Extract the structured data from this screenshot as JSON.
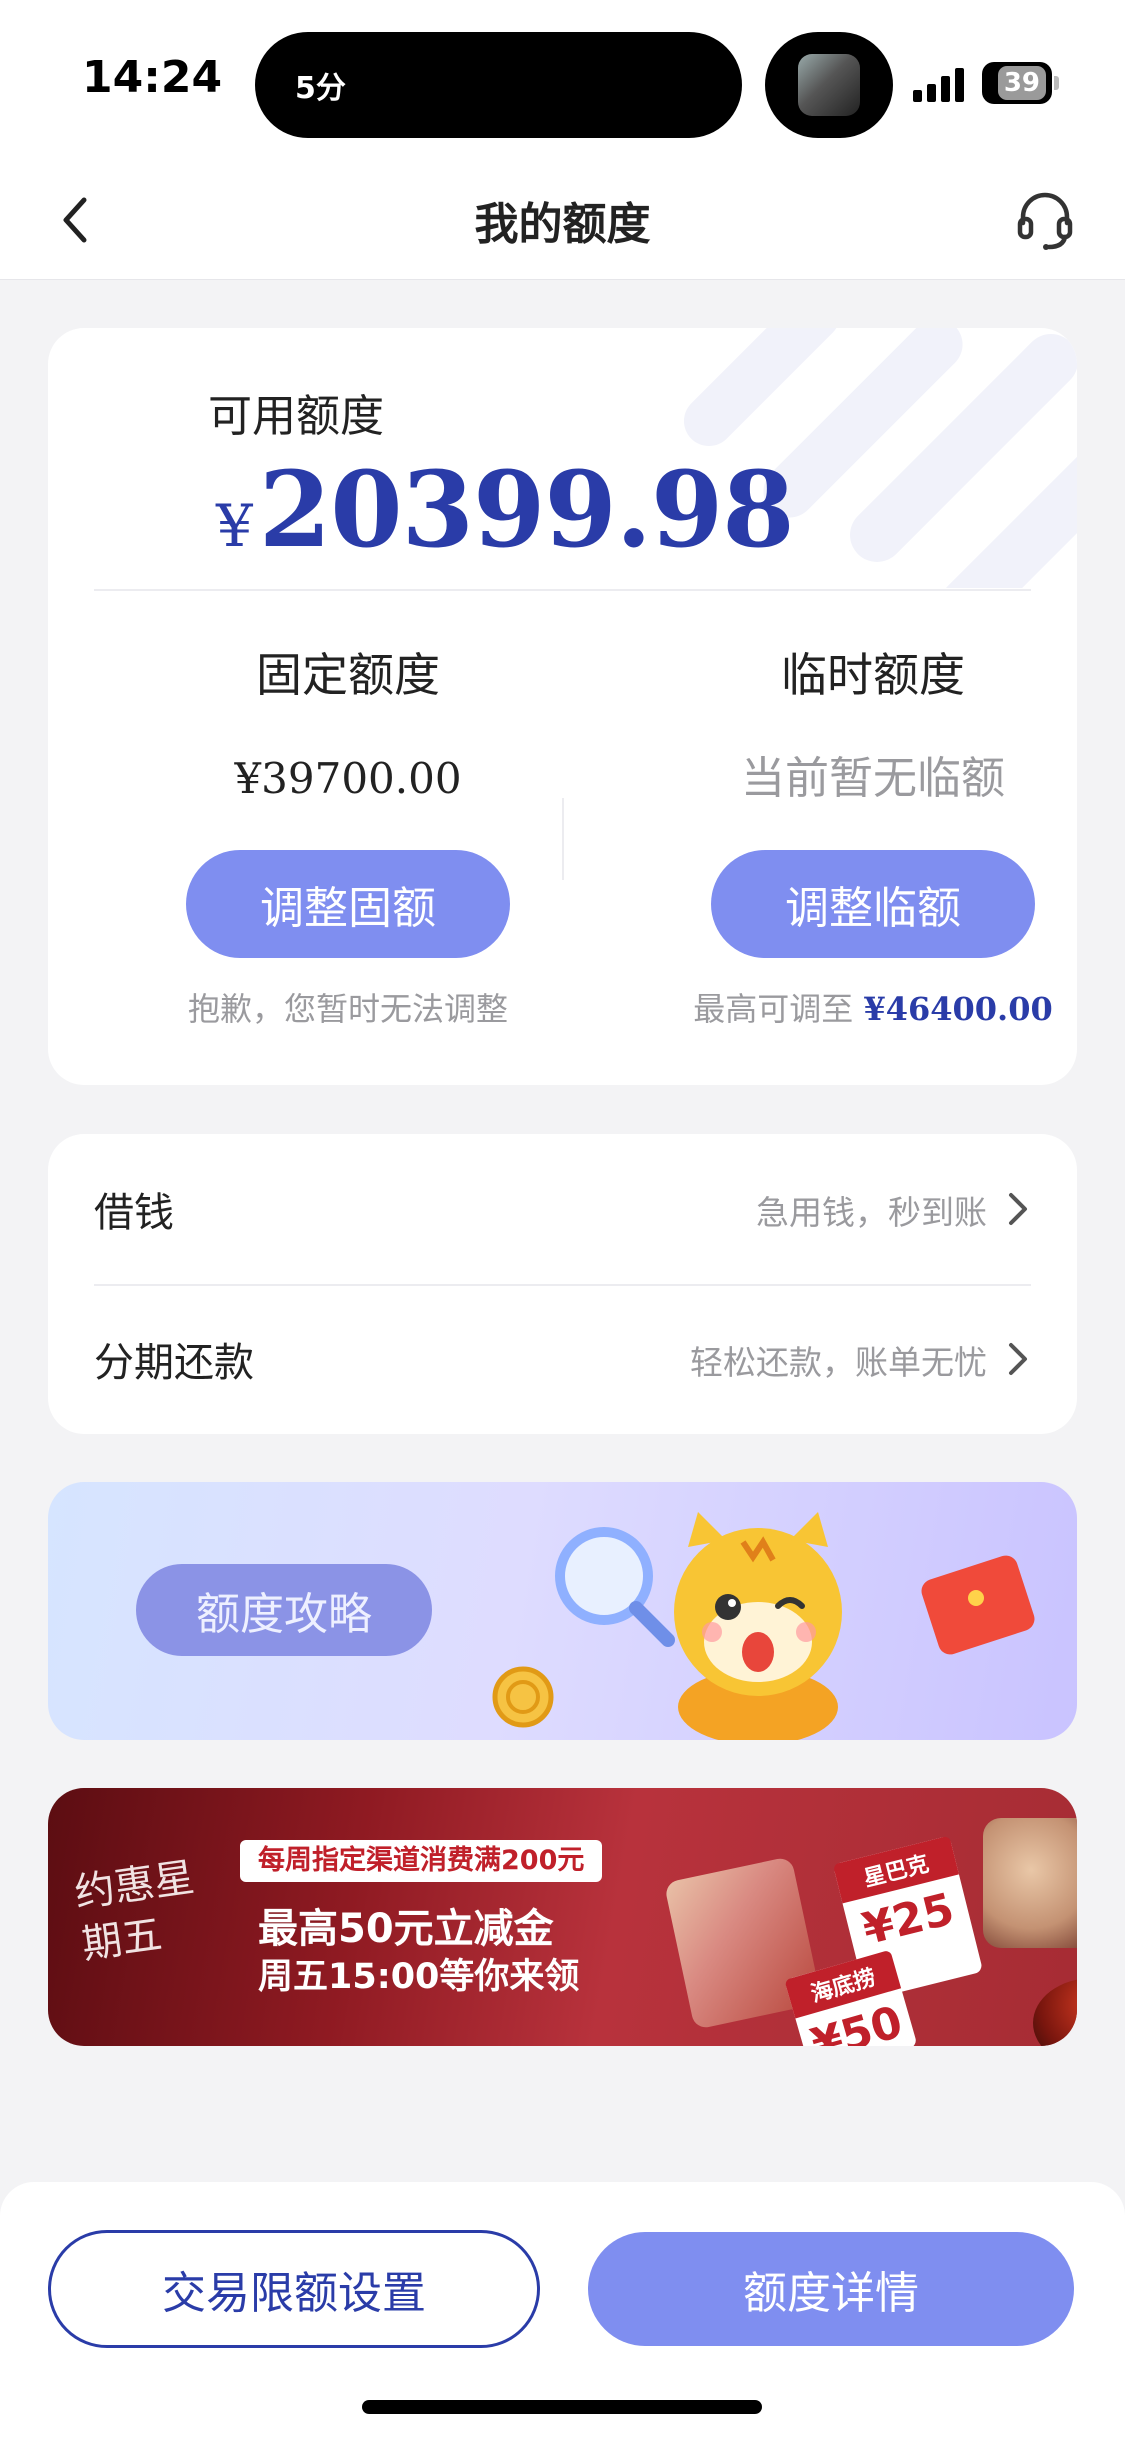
{
  "status_bar": {
    "time": "14:24",
    "island_text": "5分",
    "battery": "39"
  },
  "nav": {
    "title": "我的额度",
    "back_icon": "chevron-left-icon",
    "service_icon": "headset-icon"
  },
  "credit": {
    "available_label": "可用额度",
    "currency": "¥",
    "available_amount": "20399.98",
    "fixed": {
      "title": "固定额度",
      "value": "¥39700.00",
      "button": "调整固额",
      "note": "抱歉，您暂时无法调整"
    },
    "temporary": {
      "title": "临时额度",
      "value": "当前暂无临额",
      "button": "调整临额",
      "note_prefix": "最高可调至 ",
      "note_amount": "¥46400.00"
    }
  },
  "menu": {
    "items": [
      {
        "label": "借钱",
        "hint": "急用钱，秒到账"
      },
      {
        "label": "分期还款",
        "hint": "轻松还款，账单无忧"
      }
    ]
  },
  "strategy_banner": {
    "label": "额度攻略"
  },
  "promo_banner": {
    "logo_text": "约惠星期五",
    "tag": "每周指定渠道消费满200元",
    "line1": "最高50元立减金",
    "line2": "周五15:00等你来领",
    "coupon_a_brand": "星巴克",
    "coupon_a_value": "¥25",
    "coupon_b_brand": "海底捞",
    "coupon_b_value": "¥50"
  },
  "bottom": {
    "left_button": "交易限额设置",
    "right_button": "额度详情"
  },
  "colors": {
    "primary": "#7f8ef0",
    "amount_blue": "#2a3ca8",
    "muted": "#9a9a9e",
    "background": "#f3f3f5"
  }
}
